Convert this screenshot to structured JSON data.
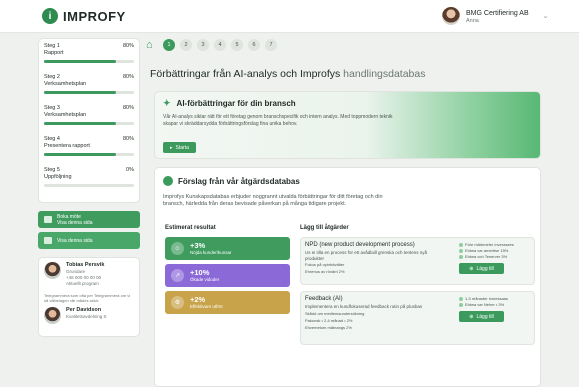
{
  "app": {
    "logo_text": "IMPROFY",
    "logo_mark": "i"
  },
  "user": {
    "company": "BMG Certifiering AB",
    "name": "Anna"
  },
  "sidebar": {
    "steps": [
      {
        "title": "Steg 1",
        "subtitle": "Rapport",
        "percent_label": "80%",
        "progress": 0.8
      },
      {
        "title": "Steg 2",
        "subtitle": "Verksamhetsplan",
        "percent_label": "80%",
        "progress": 0.8
      },
      {
        "title": "Steg 3",
        "subtitle": "Verksamhetsplan",
        "percent_label": "80%",
        "progress": 0.8
      },
      {
        "title": "Steg 4",
        "subtitle": "Presentera rapport",
        "percent_label": "80%",
        "progress": 0.8
      },
      {
        "title": "Steg 5",
        "subtitle": "Uppföljning",
        "percent_label": "0%",
        "progress": 0.0
      }
    ],
    "book_meeting": {
      "title": "Boka möte",
      "sub": "Visa denna sida"
    },
    "view_page": {
      "title": "Visa denna sida"
    },
    "contacts": [
      {
        "name": "Tobias Persvik",
        "role": "Grundare",
        "lines": [
          "+46 000 00 00 00",
          "Aktuellt program"
        ]
      },
      {
        "name": "Per Davidson",
        "role": "Kvalitetsavdelning S"
      }
    ],
    "contact_note": "Telegrammera som ofta per Telegrammera om vi så välbelagen vår mådes skick"
  },
  "nav": {
    "pages": [
      "1",
      "2",
      "3",
      "4",
      "5",
      "6",
      "7"
    ],
    "active": 0
  },
  "page": {
    "title": "Förbättringar från AI-analys och Improfys",
    "title_light": "handlingsdatabas"
  },
  "ai_card": {
    "heading": "AI-förbättringar för din bransch",
    "text": "Vår AI-analys siktar rätt för ett företag genom branschspecifik och intern analys. Med toppmodern teknik skapar vi skräddarsydda förbättringsförslag fina unika behov.",
    "button": "Starta"
  },
  "proposals": {
    "heading": "Förslag från vår åtgärdsdatabas",
    "text": "Improfys Kunskapsdatabas erbjuder noggrannt utvalda förbättringar för ditt företag och din bransch, härledda från deras bevisade påverkan på många tidigare projekt.",
    "estimated_label": "Estimerat resultat",
    "tiles": [
      {
        "value": "+3%",
        "label": "Nöjda kunder/kunsar"
      },
      {
        "value": "+10%",
        "label": "Ökade vidoder"
      },
      {
        "value": "+2%",
        "label": "Effektivare utfört"
      }
    ],
    "add_label": "Lägg till åtgärder",
    "actions": [
      {
        "title": "NPD (new product development process)",
        "desc": "Us ei tilla en process för ett avådlaill grenska och tentens nyå produkter",
        "bullets": [
          "Fokus på nyinträvälter",
          "Ehrenus av rövärri 2%"
        ],
        "right": [
          "Före märkmeter inverasees",
          "Ehtwa var amertise 15%",
          "Ehtwa och Tenerver 3%"
        ],
        "button": "Lägg till"
      },
      {
        "title": "Feedback (AI)",
        "desc": "Implementera en kundfokuserad feedback rutin på plusbas",
        "bullets": [
          "Skådd om medlemsundersökning",
          "Pakunsk • 2-4 månad • 2%",
          "Ehvemetum mätnangs 2%"
        ],
        "right": [
          "1-3 månader inmessaas",
          "Ehtwa var Neher • 3%"
        ],
        "button": "Lägg till"
      }
    ]
  },
  "colors": {
    "accent": "#3b9a5c",
    "tile_green": "#3f9c5e",
    "tile_purple": "#8b6ad8",
    "tile_gold": "#c8a349"
  }
}
